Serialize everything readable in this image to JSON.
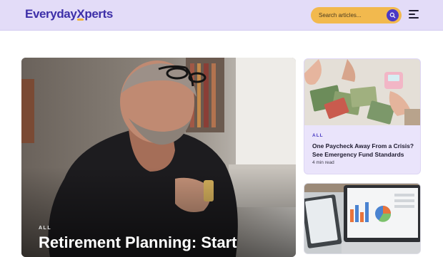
{
  "header": {
    "logo_part1": "Everyday",
    "logo_x": "X",
    "logo_part2": "perts",
    "search_placeholder": "Search articles...",
    "search_icon": "search-icon",
    "menu_icon": "menu-icon"
  },
  "featured": {
    "category": "ALL",
    "title": "Retirement Planning: Start"
  },
  "cards": [
    {
      "category": "ALL",
      "title": "One Paycheck Away From a Crisis? See Emergency Fund Standards",
      "read_time": "4 min read"
    }
  ],
  "colors": {
    "header_bg": "#e3dcf8",
    "brand": "#3d2fa8",
    "accent": "#f2b94e",
    "search_button": "#4b39c6"
  }
}
